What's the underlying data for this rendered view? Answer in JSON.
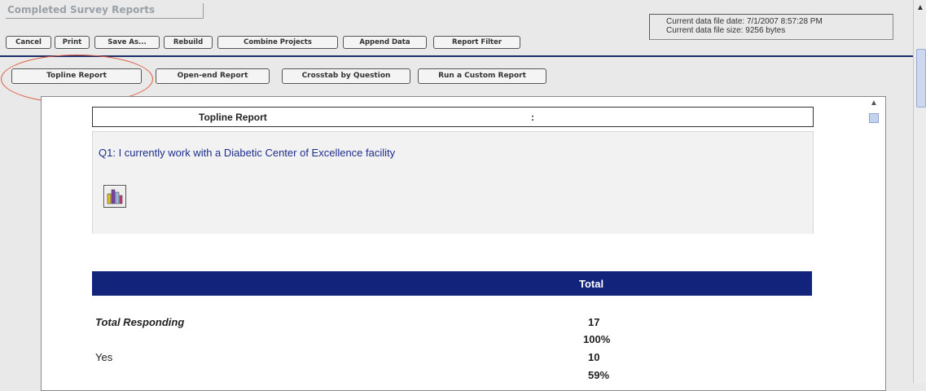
{
  "window": {
    "title": "Completed Survey Reports"
  },
  "info": {
    "file_date": "Current data file date: 7/1/2007 8:57:28 PM",
    "file_size": "Current data file size: 9256 bytes"
  },
  "toolbar": {
    "cancel": "Cancel",
    "print": "Print",
    "save_as": "Save As...",
    "rebuild": "Rebuild",
    "combine_projects": "Combine Projects",
    "append_data": "Append Data",
    "report_filter": "Report Filter"
  },
  "report_tabs": {
    "topline": "Topline Report",
    "open_end": "Open-end Report",
    "crosstab": "Crosstab by Question",
    "custom": "Run a Custom Report"
  },
  "report": {
    "header_title": "Topline Report",
    "header_sep": ":",
    "question": "Q1: I currently work with a Diabetic Center of Excellence facility",
    "chart_icon": "bar-chart-icon",
    "column_header": "Total",
    "rows": [
      {
        "label": "Total Responding",
        "count": "17",
        "pct": "100%"
      },
      {
        "label": "Yes",
        "count": "10",
        "pct": "59%"
      }
    ]
  },
  "colors": {
    "accent_navy": "#11237a",
    "question_blue": "#1d2e8c",
    "highlight_ring": "#e0583a"
  }
}
